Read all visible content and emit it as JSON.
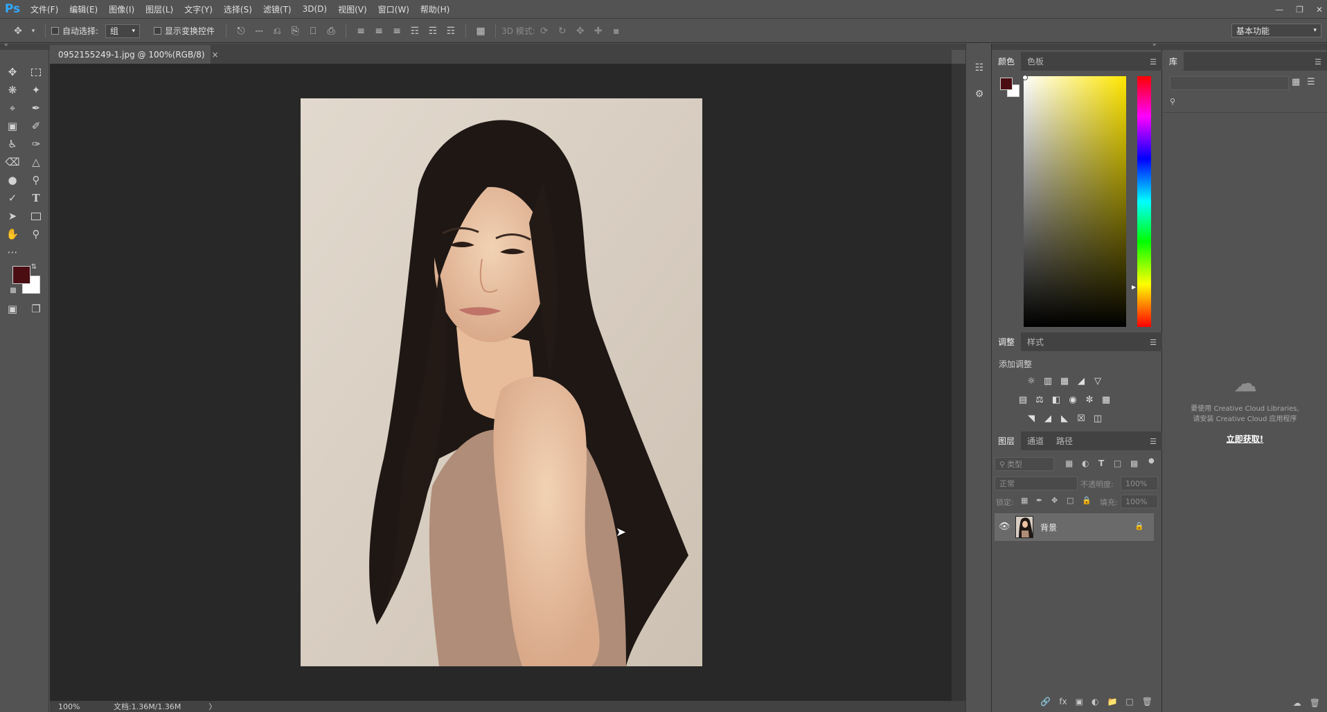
{
  "app": {
    "logo": "Ps"
  },
  "menu": [
    "文件(F)",
    "编辑(E)",
    "图像(I)",
    "图层(L)",
    "文字(Y)",
    "选择(S)",
    "滤镜(T)",
    "3D(D)",
    "视图(V)",
    "窗口(W)",
    "帮助(H)"
  ],
  "options": {
    "auto_select_label": "自动选择:",
    "auto_select_value": "组",
    "show_transform_label": "显示变换控件",
    "mode_3d_label": "3D 模式:",
    "workspace": "基本功能"
  },
  "document": {
    "tab_title": "0952155249-1.jpg @ 100%(RGB/8)",
    "tab_close": "×"
  },
  "status": {
    "zoom": "100%",
    "doc_info": "文档:1.36M/1.36M",
    "arrow": "〉"
  },
  "colors": {
    "foreground": "#4a0d12",
    "background": "#ffffff"
  },
  "color_panel": {
    "tabs": [
      "颜色",
      "色板"
    ]
  },
  "adjustments_panel": {
    "tabs": [
      "调整",
      "样式"
    ],
    "add_label": "添加调整"
  },
  "layers_panel": {
    "tabs": [
      "图层",
      "通道",
      "路径"
    ],
    "filter_placeholder": "类型",
    "blend_mode": "正常",
    "opacity_label": "不透明度:",
    "opacity_value": "100%",
    "lock_label": "锁定:",
    "fill_label": "填充:",
    "fill_value": "100%",
    "layers": [
      {
        "name": "背景",
        "visible": true,
        "locked": true
      }
    ]
  },
  "library_panel": {
    "tab": "库",
    "note_line1": "要使用 Creative Cloud Libraries,",
    "note_line2": "请安装 Creative Cloud 应用程序",
    "cta": "立即获取!"
  }
}
